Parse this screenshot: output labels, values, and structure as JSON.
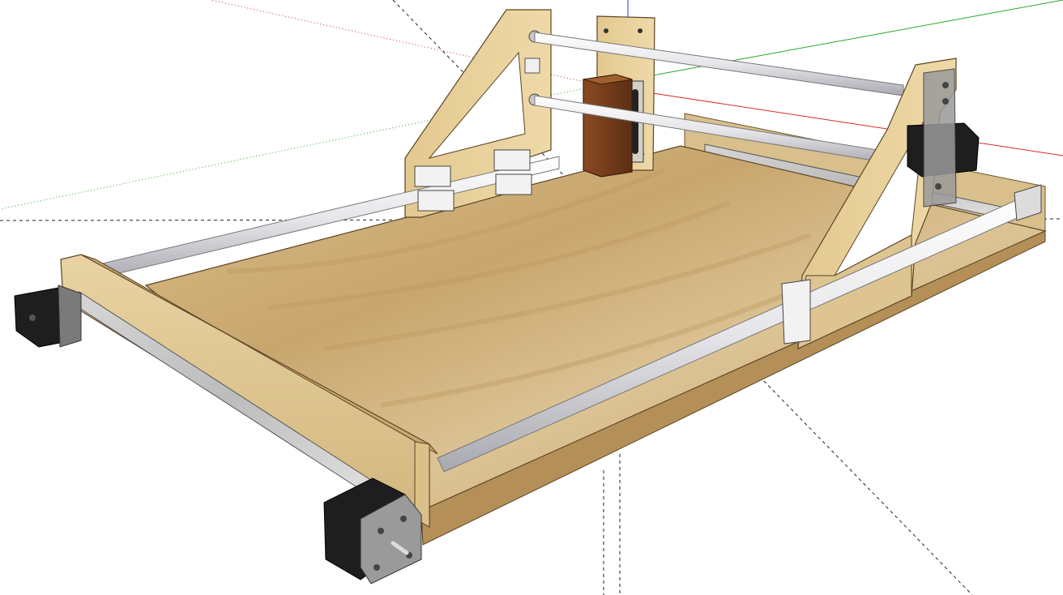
{
  "scene": {
    "background": "#ffffff",
    "axes": {
      "red": "#d62a2a",
      "green": "#2aa52a",
      "blue": "#2a3ad6"
    },
    "materials": {
      "wood_light": "#e6cf9b",
      "wood_mid": "#d2b27a",
      "wood_dark": "#b38c52",
      "wood_edge": "#8c6a3a",
      "rod": "#e9e9ec",
      "rod_shade": "#a9a9b0",
      "motor": "#1e1e1e",
      "motor_plate": "#9a9a9a",
      "bearing": "#f2f2f2",
      "aluminum": "#c9c9c9",
      "spindle": "#6e3a1c"
    },
    "objects": [
      "cnc-base-board",
      "front-end-board",
      "left-gantry-plate",
      "right-gantry-plate",
      "z-carriage-plate",
      "spindle-block",
      "x-rails",
      "y-rails",
      "stepper-motors"
    ]
  }
}
